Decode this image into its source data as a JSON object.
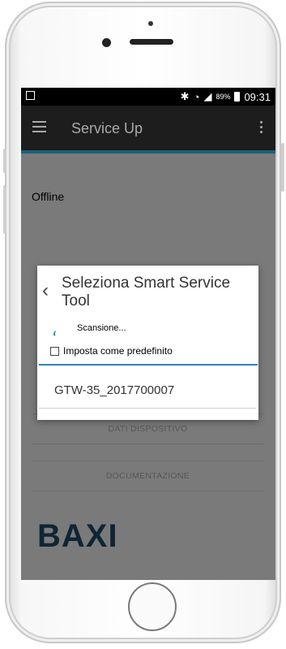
{
  "statusbar": {
    "battery": "89%",
    "time": "09:31"
  },
  "appbar": {
    "title": "Service Up"
  },
  "main": {
    "status": "Offline",
    "buttons": [
      "DATI DISPOSITIVO",
      "DOCUMENTAZIONE"
    ],
    "logo": "BAXI"
  },
  "dialog": {
    "back_glyph": "‹",
    "title": "Seleziona Smart Service Tool",
    "scan_text": "Scansione...",
    "checkbox_label": "Imposta come predefinito",
    "devices": [
      "GTW-35_2017700007"
    ]
  }
}
